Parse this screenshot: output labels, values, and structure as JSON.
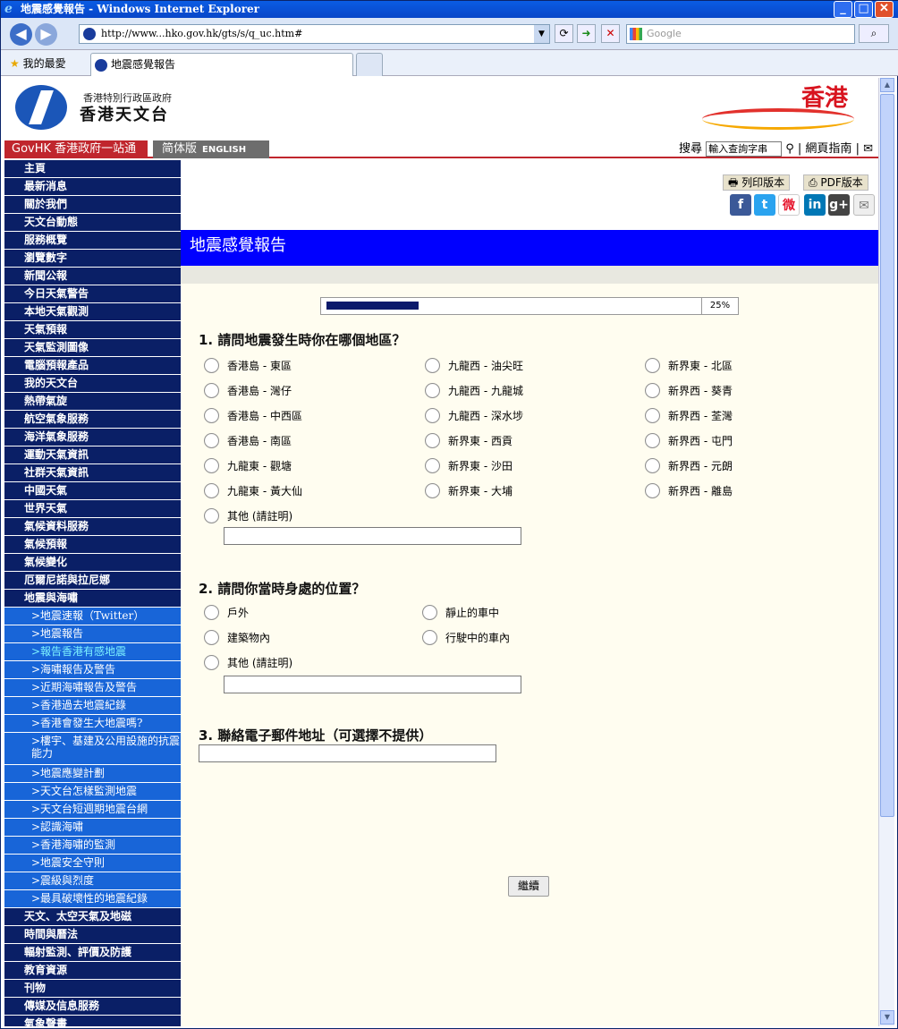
{
  "window": {
    "title": "地震感覺報告 - Windows Internet Explorer",
    "min": "_",
    "max": "□",
    "close": "✕"
  },
  "toolbar": {
    "url": "http://www...hko.gov.hk/gts/s/q_uc.htm#",
    "search_placeholder": "Google",
    "back": "◀",
    "forward": "▶",
    "refresh": "⟳",
    "go": "➜",
    "stop": "✕",
    "search_btn": "⌕"
  },
  "tabs": {
    "favorites": "我的最愛",
    "active_tab": "地震感覺報告"
  },
  "header": {
    "org_line1": "香港特別行政區政府",
    "org_line2": "香港天文台",
    "brand": "香港"
  },
  "govbar": {
    "govhk": "GovHK 香港政府一站通",
    "simplified": "简体版",
    "english": "ENGLISH",
    "search_label": "搜尋",
    "search_placeholder": "輸入查詢字串",
    "sitemap": "網頁指南"
  },
  "sidebar": {
    "items": [
      {
        "label": "主頁"
      },
      {
        "label": "最新消息"
      },
      {
        "label": "關於我們"
      },
      {
        "label": "天文台動態"
      },
      {
        "label": "服務概覽"
      },
      {
        "label": "瀏覽數字"
      },
      {
        "label": "新聞公報"
      },
      {
        "label": "今日天氣警告"
      },
      {
        "label": "本地天氣觀測"
      },
      {
        "label": "天氣預報"
      },
      {
        "label": "天氣監測圖像"
      },
      {
        "label": "電腦預報產品"
      },
      {
        "label": "我的天文台"
      },
      {
        "label": "熱帶氣旋"
      },
      {
        "label": "航空氣象服務"
      },
      {
        "label": "海洋氣象服務"
      },
      {
        "label": "運動天氣資訊"
      },
      {
        "label": "社群天氣資訊"
      },
      {
        "label": "中國天氣"
      },
      {
        "label": "世界天氣"
      },
      {
        "label": "氣候資料服務"
      },
      {
        "label": "氣候預報"
      },
      {
        "label": "氣候變化"
      },
      {
        "label": "厄爾尼諾與拉尼娜"
      },
      {
        "label": "地震與海嘯"
      }
    ],
    "subitems": [
      {
        "label": ">地震速報（Twitter）"
      },
      {
        "label": ">地震報告"
      },
      {
        "label": ">報告香港有感地震"
      },
      {
        "label": ">海嘯報告及警告"
      },
      {
        "label": ">近期海嘯報告及警告"
      },
      {
        "label": ">香港過去地震紀錄"
      },
      {
        "label": ">香港會發生大地震嗎?"
      },
      {
        "label": ">樓宇、基建及公用設施的抗震能力"
      },
      {
        "label": ">地震應變計劃"
      },
      {
        "label": ">天文台怎樣監測地震"
      },
      {
        "label": ">天文台短週期地震台網"
      },
      {
        "label": ">認識海嘯"
      },
      {
        "label": ">香港海嘯的監測"
      },
      {
        "label": ">地震安全守則"
      },
      {
        "label": ">震級與烈度"
      },
      {
        "label": ">最具破壞性的地震紀錄"
      }
    ],
    "items_after": [
      {
        "label": "天文、太空天氣及地磁"
      },
      {
        "label": "時間與曆法"
      },
      {
        "label": "輻射監測、評價及防護"
      },
      {
        "label": "教育資源"
      },
      {
        "label": "刊物"
      },
      {
        "label": "傳媒及信息服務"
      },
      {
        "label": "氣象聲畫"
      }
    ]
  },
  "actions": {
    "print": "列印版本",
    "pdf": "PDF版本"
  },
  "social": {
    "facebook": "f",
    "twitter": "t",
    "weibo": "微",
    "linkedin": "in",
    "gplus": "g+",
    "email": "✉"
  },
  "page": {
    "title": "地震感覺報告"
  },
  "progress": {
    "percent_label": "25%",
    "value": 0.25
  },
  "q1": {
    "title": "1. 請問地震發生時你在哪個地區？",
    "col1": [
      "香港島 - 東區",
      "香港島 - 灣仔",
      "香港島 - 中西區",
      "香港島 - 南區",
      "九龍東 - 觀塘",
      "九龍東 - 黃大仙",
      "其他 (請註明)"
    ],
    "col2": [
      "九龍西 - 油尖旺",
      "九龍西 - 九龍城",
      "九龍西 - 深水埗",
      "新界東 - 西貢",
      "新界東 - 沙田",
      "新界東 - 大埔"
    ],
    "col3": [
      "新界東 - 北區",
      "新界西 - 葵青",
      "新界西 - 荃灣",
      "新界西 - 屯門",
      "新界西 - 元朗",
      "新界西 - 離島"
    ]
  },
  "q2": {
    "title": "2. 請問你當時身處的位置？",
    "col1": [
      "戶外",
      "建築物內",
      "其他 (請註明)"
    ],
    "col2": [
      "靜止的車中",
      "行駛中的車內"
    ]
  },
  "q3": {
    "title": "3. 聯絡電子郵件地址（可選擇不提供）"
  },
  "submit": {
    "label": "繼續"
  }
}
